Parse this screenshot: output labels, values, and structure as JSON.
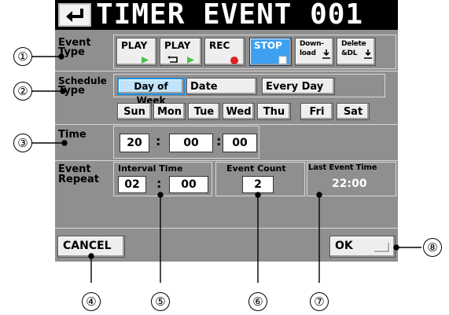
{
  "title": "TIMER EVENT 001",
  "event_type": {
    "label_line1": "Event",
    "label_line2": "Type",
    "buttons": [
      {
        "label": "PLAY",
        "icon": "play-triangle-icon"
      },
      {
        "label": "PLAY",
        "icon": "loop-play-icon"
      },
      {
        "label": "REC",
        "icon": "record-dot-icon"
      },
      {
        "label": "STOP",
        "icon": "stop-square-icon",
        "selected": true
      },
      {
        "label_line1": "Down-",
        "label_line2": "load",
        "icon": "download-arrow-icon"
      },
      {
        "label_line1": "Delete",
        "label_line2": "&DL",
        "icon": "download-arrow-icon"
      }
    ]
  },
  "schedule_type": {
    "label_line1": "Schedule",
    "label_line2": "Type",
    "options": [
      {
        "label": "Day of Week",
        "selected": true
      },
      {
        "label": "Date"
      },
      {
        "label": "Every Day"
      }
    ],
    "days": [
      "Sun",
      "Mon",
      "Tue",
      "Wed",
      "Thu",
      "Fri",
      "Sat"
    ]
  },
  "time": {
    "label": "Time",
    "hour": "20",
    "minute": "00",
    "second": "00",
    "separator": ":"
  },
  "event_repeat": {
    "label_line1": "Event",
    "label_line2": "Repeat",
    "interval_title": "Interval Time",
    "interval_hour": "02",
    "interval_minute": "00",
    "count_title": "Event Count",
    "count_value": "2",
    "last_title": "Last Event Time",
    "last_value": "22:00"
  },
  "footer": {
    "cancel_label": "CANCEL",
    "ok_label": "OK"
  },
  "callouts": [
    "①",
    "②",
    "③",
    "④",
    "⑤",
    "⑥",
    "⑦",
    "⑧"
  ],
  "colors": {
    "screen_bg": "#8f8f8f",
    "title_bar": "#000000",
    "selected_button": "#3ea0f0",
    "record_dot": "#e02020",
    "play_triangle": "#4ac04a"
  }
}
